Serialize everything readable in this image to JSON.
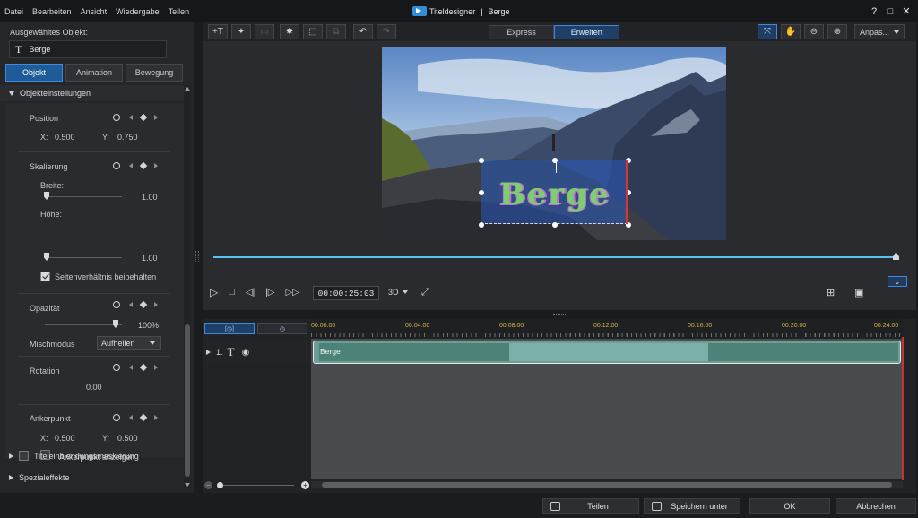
{
  "menu": [
    "Datei",
    "Bearbeiten",
    "Ansicht",
    "Wiedergabe",
    "Teilen"
  ],
  "window": {
    "title": "Titeldesigner",
    "separator": "|",
    "document": "Berge",
    "help": "?",
    "restore": "□",
    "close": "✕"
  },
  "left": {
    "selected_label": "Ausgewähltes Objekt:",
    "object_icon": "T",
    "object_name": "Berge",
    "tabs": [
      "Objekt",
      "Animation",
      "Bewegung"
    ],
    "section_title": "Objekteinstellungen",
    "position": {
      "label": "Position",
      "x_label": "X:",
      "x": "0.500",
      "y_label": "Y:",
      "y": "0.750"
    },
    "scaling": {
      "label": "Skalierung",
      "width_label": "Breite:",
      "width_value": "1.00",
      "height_label": "Höhe:",
      "height_value": "1.00",
      "keep_ratio": "Seitenverhältnis beibehalten"
    },
    "opacity": {
      "label": "Opazität",
      "value": "100%"
    },
    "blend": {
      "label": "Mischmodus",
      "value": "Aufhellen"
    },
    "rotation": {
      "label": "Rotation",
      "value": "0.00"
    },
    "anchor": {
      "label": "Ankerpunkt",
      "x_label": "X:",
      "x": "0.500",
      "y_label": "Y:",
      "y": "0.500",
      "show": "Ankerpunkt anzeigen"
    },
    "collapsed": [
      "Titeleinblendungsmaskierung",
      "Spezialeffekte"
    ]
  },
  "toolbar": {
    "modes": [
      "Express",
      "Erweitert"
    ],
    "fit": "Anpas..."
  },
  "preview": {
    "title_text": "Berge",
    "timecode": "00:00:25:03",
    "mode_3d": "3D"
  },
  "timeline": {
    "ticks": [
      "00:00:00",
      "00:04:00",
      "00:08:00",
      "00:12:00",
      "00:16:00",
      "00:20:00",
      "00:24:00"
    ],
    "track_number": "1.",
    "track_icon": "T",
    "clip_name": "Berge"
  },
  "footer": {
    "share": "Teilen",
    "save_as": "Speichern unter",
    "ok": "OK",
    "cancel": "Abbrechen"
  },
  "colors": {
    "accent": "#3d8ae0",
    "timeline_progress": "#55c2ef",
    "playhead": "#c7332f",
    "clip": "#6a9f97"
  }
}
